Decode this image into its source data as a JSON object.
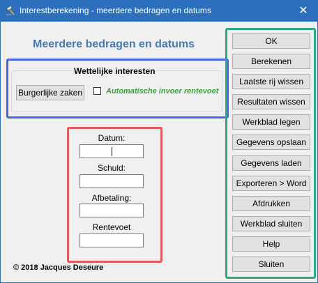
{
  "window": {
    "title": "Interestberekening - meerdere bedragen en datums",
    "close_glyph": "✕",
    "icon": "gavel-icon"
  },
  "heading": "Meerdere bedragen en datums",
  "legal_group": {
    "legend": "Wettelijke interesten",
    "button_label": "Burgerlijke zaken",
    "checkbox_label": "Automatische invoer rentevoet",
    "checkbox_checked": false
  },
  "fields": [
    {
      "label": "Datum:",
      "value": ""
    },
    {
      "label": "Schuld:",
      "value": ""
    },
    {
      "label": "Afbetaling:",
      "value": ""
    },
    {
      "label": "Rentevoet",
      "value": ""
    }
  ],
  "right_buttons": [
    "OK",
    "Berekenen",
    "Laatste rij wissen",
    "Resultaten wissen",
    "Werkblad legen",
    "Gegevens opslaan",
    "Gegevens laden",
    "Exporteren > Word",
    "Afdrukken",
    "Werkblad sluiten",
    "Help",
    "Sluiten"
  ],
  "copyright": "© 2018 Jacques Deseure",
  "colors": {
    "titlebar": "#2b6fbd",
    "heading": "#4479b5",
    "checkbox_label": "#3aa23a",
    "outline_blue": "#4666df",
    "outline_red": "#e35a5a",
    "outline_teal": "#2fa886"
  }
}
